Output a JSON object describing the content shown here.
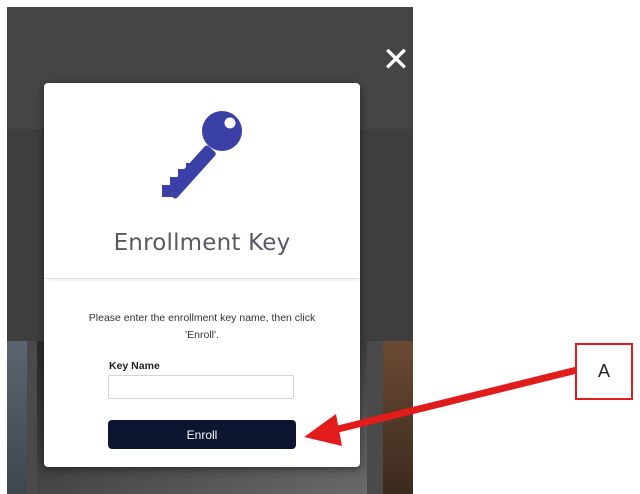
{
  "dialog": {
    "close_glyph": "✕",
    "title": "Enrollment Key",
    "icon": "key-icon",
    "instructions": "Please enter the enrollment key name, then click 'Enroll'.",
    "field_label": "Key Name",
    "field_value": "",
    "field_placeholder": "",
    "enroll_label": "Enroll"
  },
  "annotation": {
    "label": "A",
    "color": "#e21b1b"
  },
  "colors": {
    "icon": "#3a40a6",
    "button": "#0e1530",
    "overlay": "#4a4a4a"
  }
}
